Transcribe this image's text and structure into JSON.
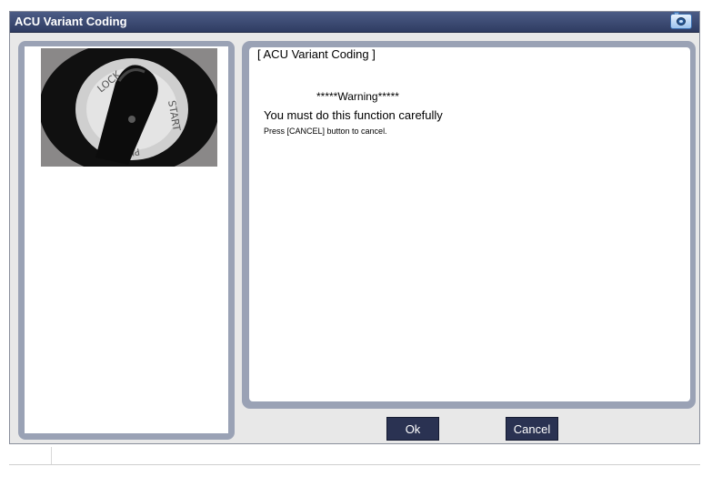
{
  "window": {
    "title": "ACU Variant Coding",
    "camera_icon": "camera-icon"
  },
  "left_panel": {
    "image_alt": "Ignition key switch"
  },
  "content": {
    "header": "[ ACU Variant Coding ]",
    "warning": "*****Warning*****",
    "message": "You must do this function carefully",
    "sub_message": "Press [CANCEL] button to cancel."
  },
  "buttons": {
    "ok_label": "Ok",
    "cancel_label": "Cancel"
  },
  "colors": {
    "titlebar": "#2f3c62",
    "button": "#2a3252",
    "panel_border": "#9aa2b5"
  }
}
